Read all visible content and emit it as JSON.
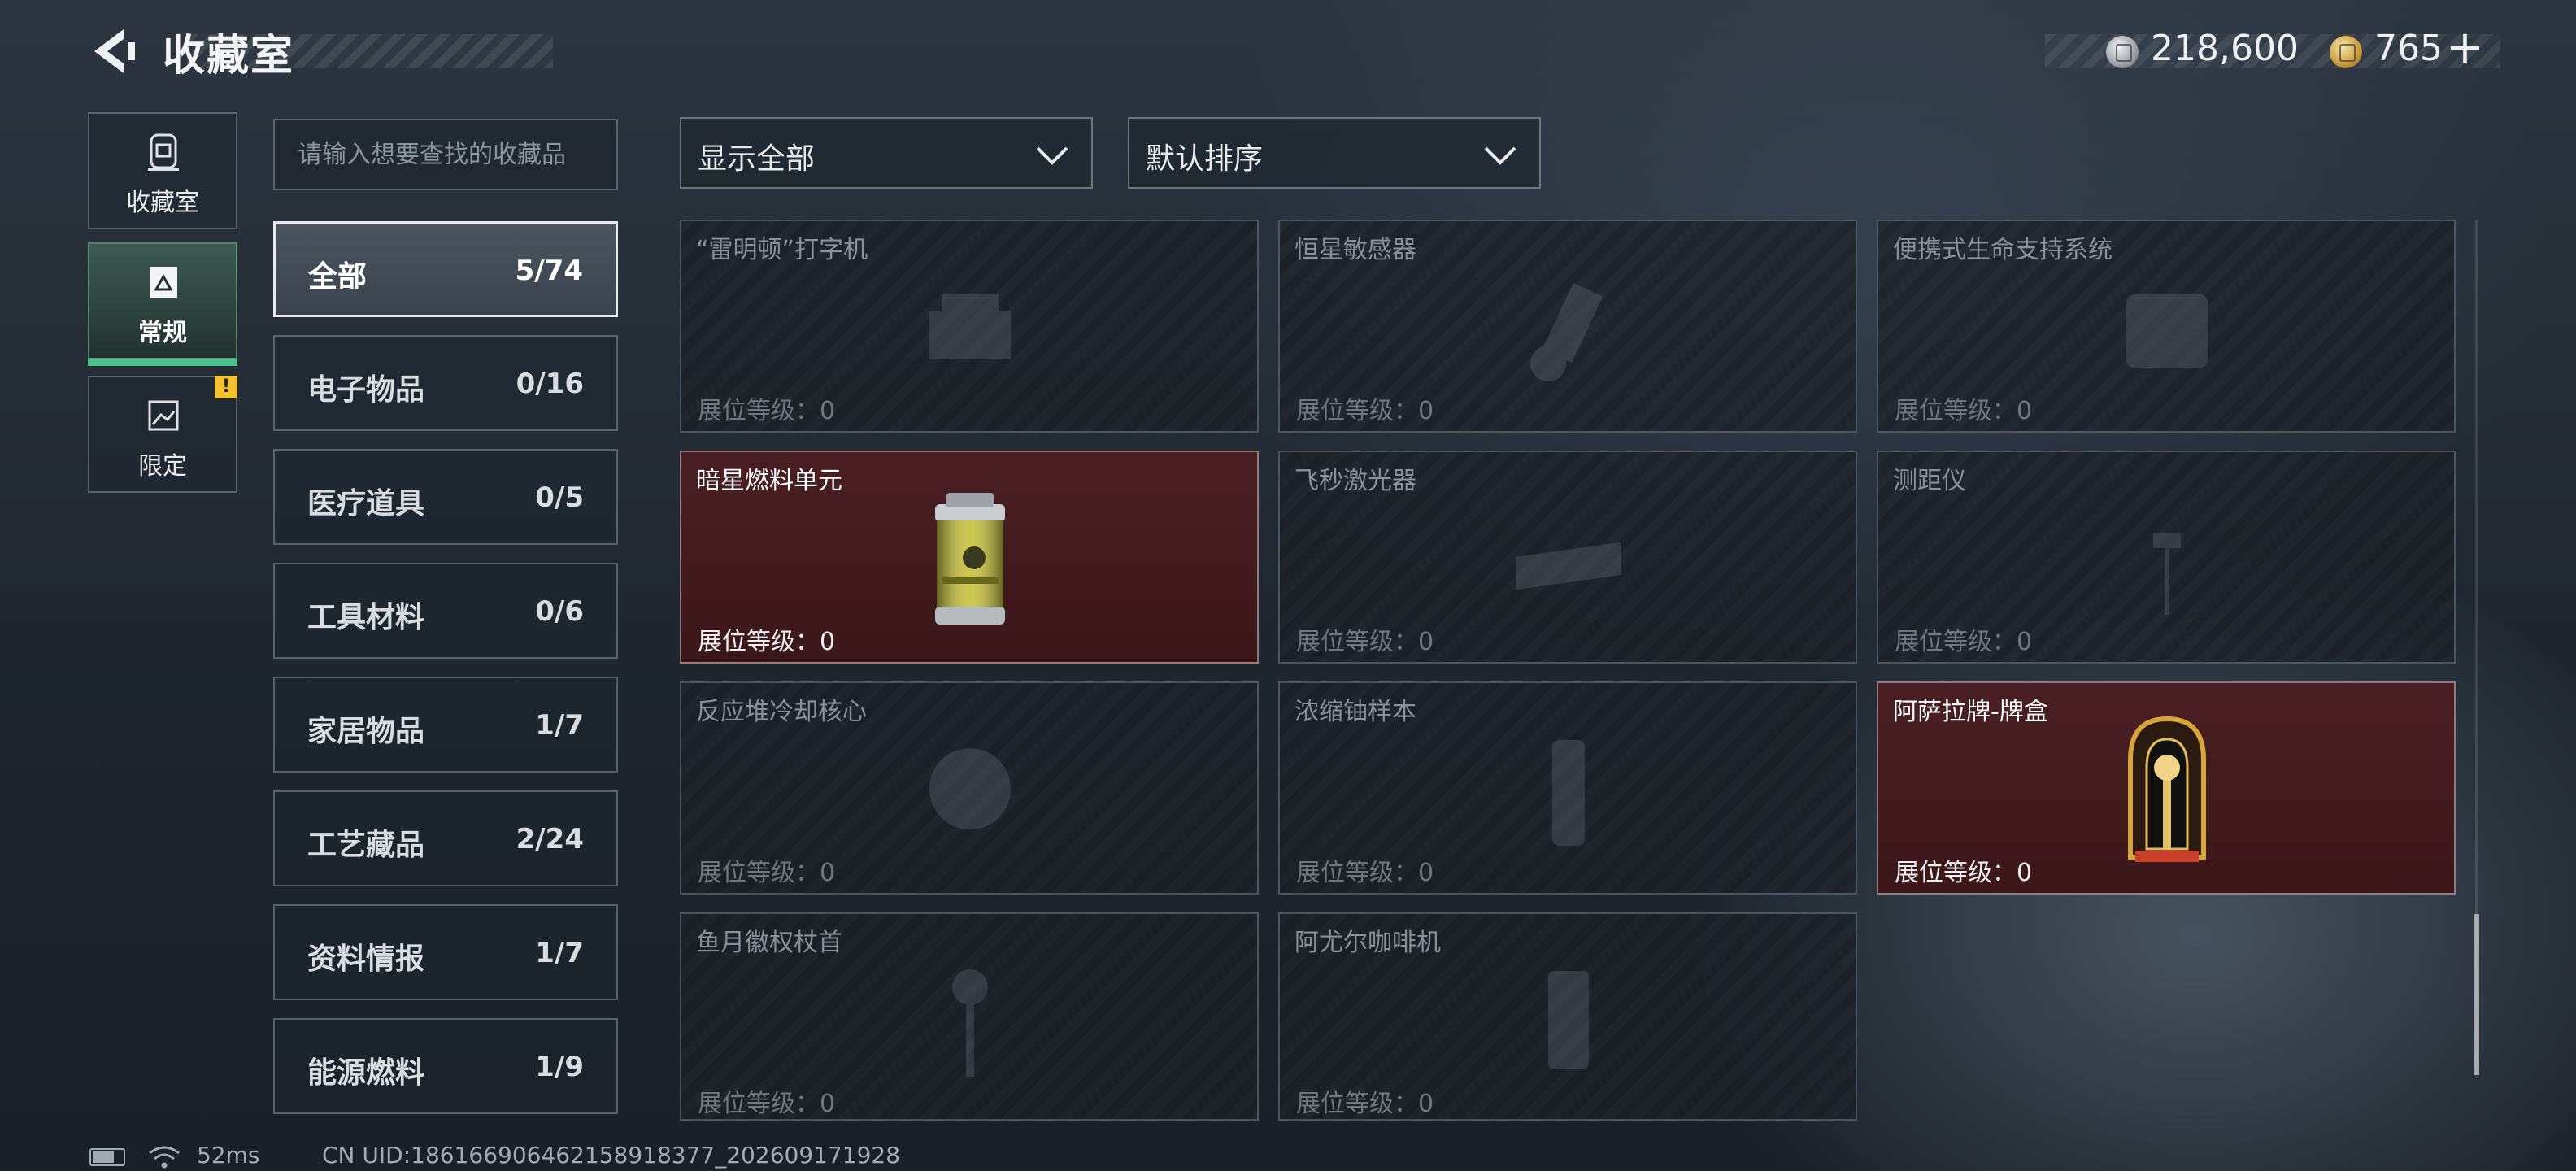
{
  "header": {
    "title": "收藏室",
    "currencies": [
      {
        "icon": "silver-coin-icon",
        "value": "218,600"
      },
      {
        "icon": "gold-coin-icon",
        "value": "765"
      }
    ],
    "plus_label": "+"
  },
  "side_tabs": [
    {
      "label": "收藏室",
      "icon": "collection-room-icon"
    },
    {
      "label": "常规",
      "icon": "regular-image-icon",
      "active": true
    },
    {
      "label": "限定",
      "icon": "limited-image-icon",
      "badge": "!"
    }
  ],
  "search": {
    "placeholder": "请输入想要查找的收藏品",
    "value": ""
  },
  "categories": [
    {
      "name": "全部",
      "count": "5/74",
      "active": true
    },
    {
      "name": "电子物品",
      "count": "0/16"
    },
    {
      "name": "医疗道具",
      "count": "0/5"
    },
    {
      "name": "工具材料",
      "count": "0/6"
    },
    {
      "name": "家居物品",
      "count": "1/7"
    },
    {
      "name": "工艺藏品",
      "count": "2/24"
    },
    {
      "name": "资料情报",
      "count": "1/7"
    },
    {
      "name": "能源燃料",
      "count": "1/9"
    }
  ],
  "filters": {
    "display": "显示全部",
    "sort": "默认排序"
  },
  "items": [
    {
      "name": "“雷明顿”打字机",
      "level": "展位等级：0",
      "owned": false
    },
    {
      "name": "恒星敏感器",
      "level": "展位等级：0",
      "owned": false
    },
    {
      "name": "便携式生命支持系统",
      "level": "展位等级：0",
      "owned": false
    },
    {
      "name": "暗星燃料单元",
      "level": "展位等级：0",
      "owned": true
    },
    {
      "name": "飞秒激光器",
      "level": "展位等级：0",
      "owned": false
    },
    {
      "name": "测距仪",
      "level": "展位等级：0",
      "owned": false
    },
    {
      "name": "反应堆冷却核心",
      "level": "展位等级：0",
      "owned": false
    },
    {
      "name": "浓缩铀样本",
      "level": "展位等级：0",
      "owned": false
    },
    {
      "name": "阿萨拉牌-牌盒",
      "level": "展位等级：0",
      "owned": true
    },
    {
      "name": "鱼月徽权杖首",
      "level": "展位等级：0",
      "owned": false
    },
    {
      "name": "阿尤尔咖啡机",
      "level": "展位等级：0",
      "owned": false
    }
  ],
  "status": {
    "ping": "52ms",
    "uid": "CN UID:18616690646215891837​7_202609171928"
  },
  "colors": {
    "accent_green": "#43c48a",
    "owned_card": "#4a1f23",
    "warning": "#f3c232"
  }
}
